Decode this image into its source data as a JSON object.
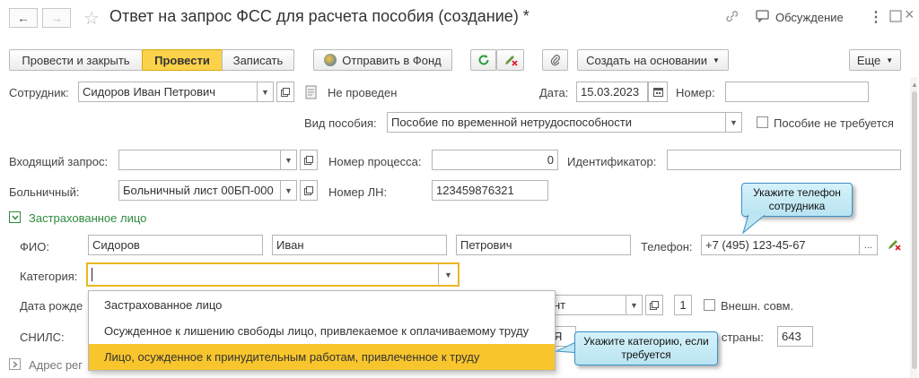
{
  "window": {
    "title": "Ответ на запрос ФСС для расчета пособия (создание) *",
    "discussion_label": "Обсуждение"
  },
  "toolbar": {
    "post_close_label": "Провести и закрыть",
    "post_label": "Провести",
    "save_label": "Записать",
    "send_fund_label": "Отправить в Фонд",
    "create_based_label": "Создать на основании",
    "more_label": "Еще"
  },
  "form": {
    "employee_label": "Сотрудник:",
    "employee_value": "Сидоров Иван Петрович",
    "not_posted_label": "Не проведен",
    "date_label": "Дата:",
    "date_value": "15.03.2023",
    "number_label": "Номер:",
    "number_value": "",
    "benefit_type_label": "Вид пособия:",
    "benefit_type_value": "Пособие по временной нетрудоспособности",
    "benefit_not_required_label": "Пособие не требуется",
    "incoming_request_label": "Входящий запрос:",
    "incoming_request_value": "",
    "process_number_label": "Номер процесса:",
    "process_number_value": "0",
    "identifier_label": "Идентификатор:",
    "identifier_value": "",
    "sick_leave_label": "Больничный:",
    "sick_leave_value": "Больничный лист 00БП-000",
    "ln_number_label": "Номер ЛН:",
    "ln_number_value": "123459876321",
    "insured_section_label": "Застрахованное лицо",
    "fio_label": "ФИО:",
    "last_name": "Сидоров",
    "first_name": "Иван",
    "middle_name": "Петрович",
    "phone_label": "Телефон:",
    "phone_value": "+7 (495) 123-45-67",
    "category_label": "Категория:",
    "category_value": "",
    "birth_date_label": "Дата рожде",
    "partial_field_text": "нт",
    "count_value": "1",
    "external_part_time_label": "Внешн. совм.",
    "snils_label": "СНИЛС:",
    "partial_snils_text": "Я",
    "country_label": "а страны:",
    "country_value": "643",
    "address_section_label": "Адрес рег"
  },
  "category_dropdown": {
    "options": [
      "Застрахованное лицо",
      "Осужденное к лишению свободы лицо, привлекаемое к оплачиваемому труду",
      "Лицо, осужденное к принудительным работам, привлеченное к труду"
    ],
    "selected_index": 2
  },
  "callouts": {
    "phone_hint": "Укажите телефон сотрудника",
    "category_hint": "Укажите категорию, если требуется"
  },
  "colors": {
    "primary_button": "#fbd24a",
    "selected_option": "#f8c52c",
    "section_green": "#2e8b3e",
    "callout_border": "#3a8fc4",
    "active_field_border": "#e9b820"
  }
}
